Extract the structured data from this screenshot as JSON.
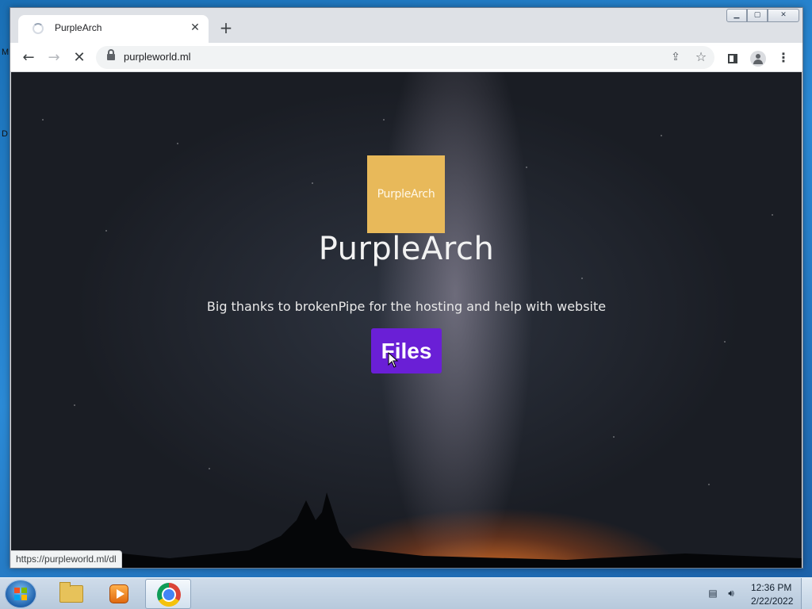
{
  "desktop": {
    "glyph_m": "M",
    "glyph_d": "D"
  },
  "browser": {
    "tab": {
      "title": "PurpleArch",
      "close": "✕"
    },
    "new_tab": "+",
    "window_controls": {
      "minimize": "▁",
      "maximize": "▢",
      "close": "✕"
    },
    "toolbar": {
      "back": "←",
      "forward": "→",
      "reload": "✕",
      "url": "purpleworld.ml",
      "share_icon": "⇪",
      "star_icon": "☆",
      "menu": "⋮"
    },
    "status_url": "https://purpleworld.ml/dl"
  },
  "page": {
    "logo_text": "PurpleArch",
    "title": "PurpleArch",
    "tagline": "Big thanks to brokenPipe for the hosting and help with website",
    "files_button": "Files",
    "colors": {
      "logo_bg": "#e8b95a",
      "button_bg": "#6a1fd6"
    }
  },
  "taskbar": {
    "items": [
      "windows-explorer",
      "windows-media-player",
      "google-chrome"
    ],
    "active": "google-chrome",
    "clock": {
      "time": "12:36 PM",
      "date": "2/22/2022"
    }
  }
}
